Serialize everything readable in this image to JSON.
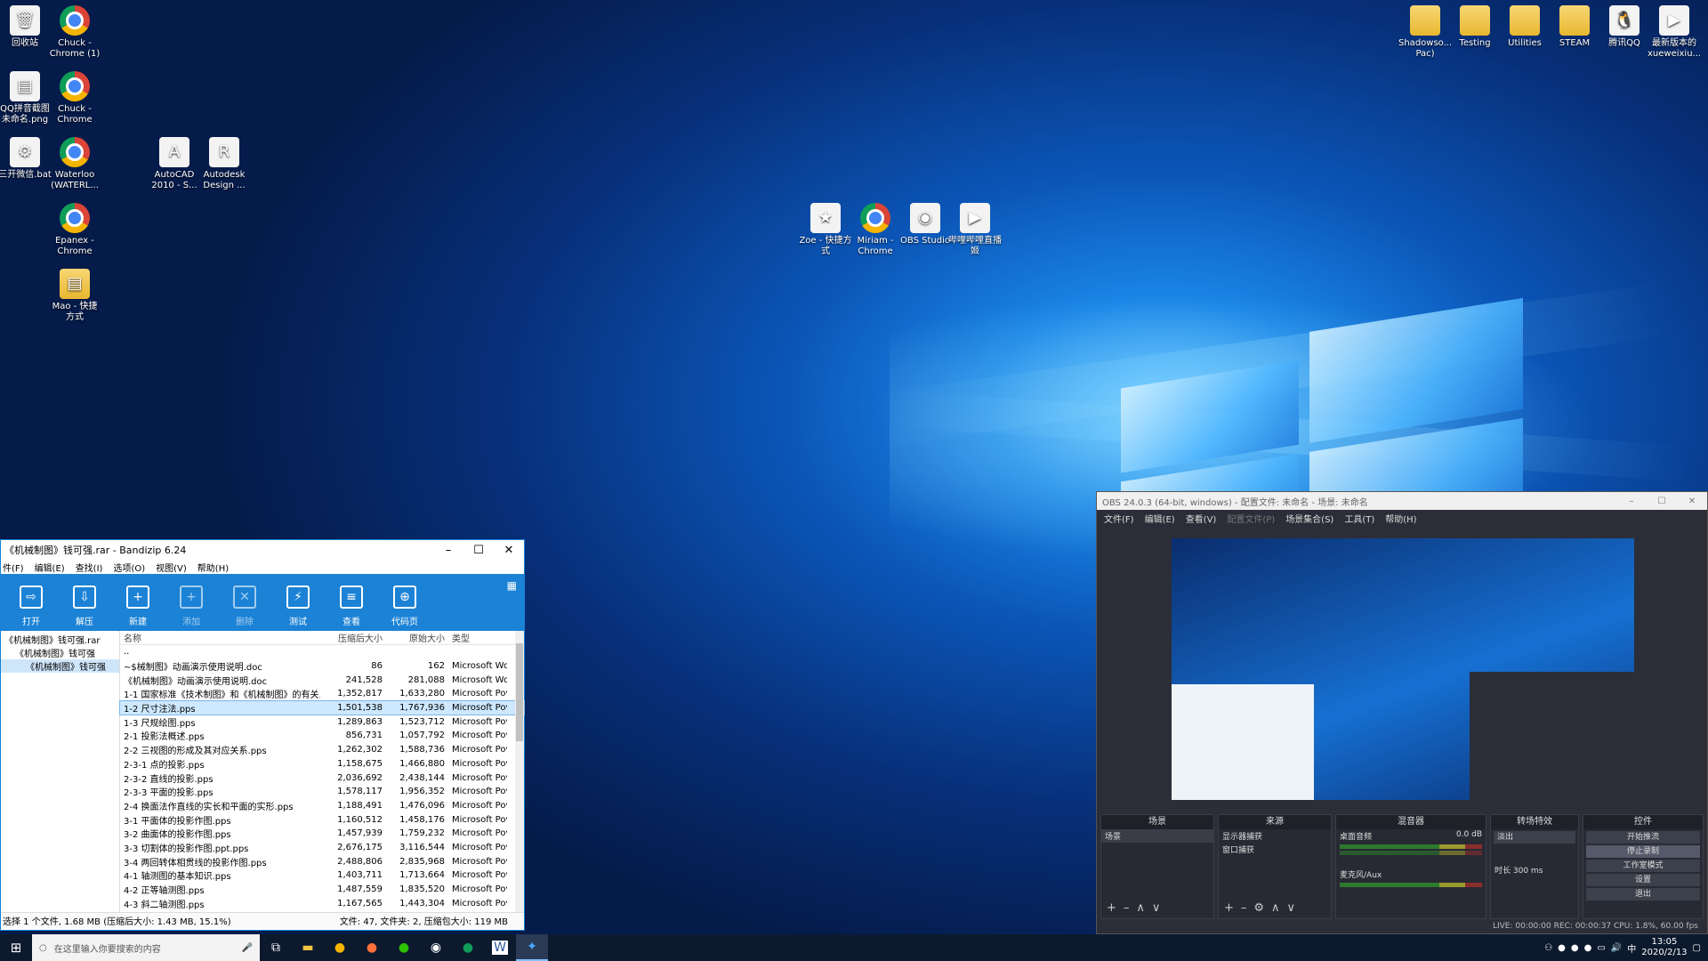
{
  "desktop": {
    "icons_left": [
      {
        "label": "回收站",
        "glyph": "🗑",
        "kind": "file"
      },
      {
        "label": "Chuck - Chrome (1)",
        "kind": "chrome"
      },
      {
        "label": "QQ拼音截图未命名.png",
        "glyph": "▤",
        "kind": "file"
      },
      {
        "label": "Chuck - Chrome",
        "kind": "chrome"
      },
      {
        "label": "三开微信.bat",
        "glyph": "⚙",
        "kind": "file"
      },
      {
        "label": "Waterloo (WATERL...",
        "kind": "chrome"
      },
      {
        "label": "AutoCAD 2010 - S...",
        "glyph": "A",
        "kind": "file"
      },
      {
        "label": "Autodesk Design ...",
        "glyph": "R",
        "kind": "file"
      },
      {
        "label": "Epanex - Chrome",
        "kind": "chrome"
      },
      {
        "label": "Mao - 快捷方式",
        "glyph": "▤",
        "kind": "folder"
      }
    ],
    "icons_mid": [
      {
        "label": "Zoe - 快捷方式",
        "glyph": "★",
        "kind": "file"
      },
      {
        "label": "Miriam - Chrome",
        "kind": "chrome"
      },
      {
        "label": "OBS Studio",
        "glyph": "◉",
        "kind": "file"
      },
      {
        "label": "哔哩哔哩直播姬",
        "glyph": "▶",
        "kind": "file"
      }
    ],
    "icons_right": [
      {
        "label": "Shadowso... Pac)",
        "kind": "folder"
      },
      {
        "label": "Testing",
        "kind": "folder"
      },
      {
        "label": "Utilities",
        "kind": "folder"
      },
      {
        "label": "STEAM",
        "kind": "folder"
      },
      {
        "label": "腾讯QQ",
        "glyph": "🐧",
        "kind": "file"
      },
      {
        "label": "最新版本的 xueweixiu...",
        "glyph": "▶",
        "kind": "file"
      }
    ]
  },
  "bandizip": {
    "title": "《机械制图》钱可强.rar - Bandizip 6.24",
    "menu": [
      "件(F)",
      "编辑(E)",
      "查找(I)",
      "选项(O)",
      "视图(V)",
      "帮助(H)"
    ],
    "toolbar": [
      {
        "label": "打开",
        "glyph": "⇨"
      },
      {
        "label": "解压",
        "glyph": "⇩"
      },
      {
        "label": "新建",
        "glyph": "+"
      },
      {
        "label": "添加",
        "glyph": "+"
      },
      {
        "label": "删除",
        "glyph": "✕"
      },
      {
        "label": "测试",
        "glyph": "⚡"
      },
      {
        "label": "查看",
        "glyph": "≡"
      },
      {
        "label": "代码页",
        "glyph": "⊕"
      }
    ],
    "tree": [
      "《机械制图》钱可强.rar",
      "《机械制图》钱可强",
      "《机械制图》钱可强"
    ],
    "columns": [
      "名称",
      "压缩后大小",
      "原始大小",
      "类型"
    ],
    "rows": [
      [
        "..",
        "",
        "",
        ""
      ],
      [
        "~$械制图》动画演示使用说明.doc",
        "86",
        "162",
        "Microsoft Wo"
      ],
      [
        "《机械制图》动画演示使用说明.doc",
        "241,528",
        "281,088",
        "Microsoft Wo"
      ],
      [
        "1-1 国家标准《技术制图》和《机械制图》的有关...",
        "1,352,817",
        "1,633,280",
        "Microsoft Pov"
      ],
      [
        "1-2 尺寸注法.pps",
        "1,501,538",
        "1,767,936",
        "Microsoft Pov"
      ],
      [
        "1-3 尺规绘图.pps",
        "1,289,863",
        "1,523,712",
        "Microsoft Pov"
      ],
      [
        "2-1 投影法概述.pps",
        "856,731",
        "1,057,792",
        "Microsoft Pov"
      ],
      [
        "2-2 三视图的形成及其对应关系.pps",
        "1,262,302",
        "1,588,736",
        "Microsoft Pov"
      ],
      [
        "2-3-1 点的投影.pps",
        "1,158,675",
        "1,466,880",
        "Microsoft Pov"
      ],
      [
        "2-3-2 直线的投影.pps",
        "2,036,692",
        "2,438,144",
        "Microsoft Pov"
      ],
      [
        "2-3-3 平面的投影.pps",
        "1,578,117",
        "1,956,352",
        "Microsoft Pov"
      ],
      [
        "2-4 换面法作直线的实长和平面的实形.pps",
        "1,188,491",
        "1,476,096",
        "Microsoft Pov"
      ],
      [
        "3-1 平面体的投影作图.pps",
        "1,160,512",
        "1,458,176",
        "Microsoft Pov"
      ],
      [
        "3-2 曲面体的投影作图.pps",
        "1,457,939",
        "1,759,232",
        "Microsoft Pov"
      ],
      [
        "3-3 切割体的投影作图.ppt.pps",
        "2,676,175",
        "3,116,544",
        "Microsoft Pov"
      ],
      [
        "3-4 两回转体相贯线的投影作图.pps",
        "2,488,806",
        "2,835,968",
        "Microsoft Pov"
      ],
      [
        "4-1 轴测图的基本知识.pps",
        "1,403,711",
        "1,713,664",
        "Microsoft Pov"
      ],
      [
        "4-2 正等轴测图.pps",
        "1,487,559",
        "1,835,520",
        "Microsoft Pov"
      ],
      [
        "4-3 斜二轴测图.pps",
        "1,167,565",
        "1,443,304",
        "Microsoft Pov"
      ]
    ],
    "selected_row": 4,
    "status_left": "选择 1 个文件, 1.68 MB (压缩后大小: 1.43 MB, 15.1%)",
    "status_right": "文件: 47, 文件夹: 2, 压缩包大小: 119 MB"
  },
  "obs": {
    "title": "OBS 24.0.3 (64-bit, windows) - 配置文件: 未命名 - 场景: 未命名",
    "menu": [
      "文件(F)",
      "编辑(E)",
      "查看(V)",
      "配置文件(P)",
      "场景集合(S)",
      "工具(T)",
      "帮助(H)"
    ],
    "docks": {
      "scenes": {
        "header": "场景",
        "items": [
          "场景"
        ]
      },
      "sources": {
        "header": "来源",
        "items": [
          "显示器捕获",
          "窗口捕获"
        ]
      },
      "mixer": {
        "header": "混音器",
        "tracks": [
          {
            "name": "桌面音频",
            "level": "0.0 dB"
          },
          {
            "name": "麦克风/Aux",
            "level": ""
          }
        ]
      },
      "transitions": {
        "header": "转场特效",
        "value": "淡出",
        "duration_label": "时长",
        "duration": "300 ms"
      },
      "controls": {
        "header": "控件",
        "buttons": [
          "开始推流",
          "停止录制",
          "工作室模式",
          "设置",
          "退出"
        ]
      }
    },
    "status": "LIVE: 00:00:00   REC: 00:00:37   CPU: 1.8%, 60.00 fps"
  },
  "taskbar": {
    "search_placeholder": "在这里输入你要搜索的内容",
    "time": "13:05",
    "date": "2020/2/13",
    "ime": "中"
  }
}
